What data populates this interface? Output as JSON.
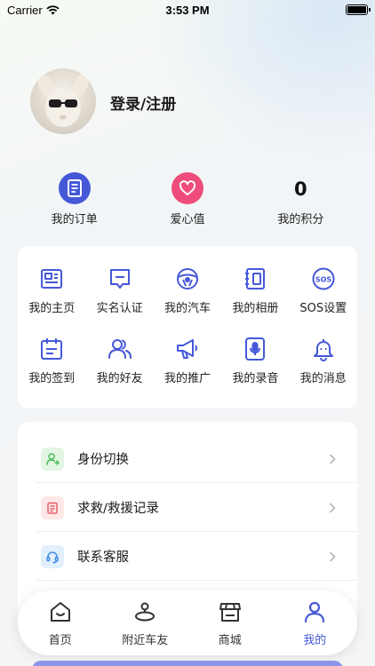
{
  "status_bar": {
    "carrier": "Carrier",
    "time": "3:53 PM"
  },
  "profile": {
    "login_label": "登录/注册"
  },
  "stats": {
    "orders_label": "我的订单",
    "love_label": "爱心值",
    "points_value": "0",
    "points_label": "我的积分"
  },
  "grid": {
    "items": [
      {
        "label": "我的主页",
        "icon": "homepage-icon"
      },
      {
        "label": "实名认证",
        "icon": "verify-icon"
      },
      {
        "label": "我的汽车",
        "icon": "steering-wheel-icon"
      },
      {
        "label": "我的相册",
        "icon": "album-icon"
      },
      {
        "label": "SOS设置",
        "icon": "sos-icon"
      },
      {
        "label": "我的签到",
        "icon": "calendar-icon"
      },
      {
        "label": "我的好友",
        "icon": "friends-icon"
      },
      {
        "label": "我的推广",
        "icon": "megaphone-icon"
      },
      {
        "label": "我的录音",
        "icon": "recording-icon"
      },
      {
        "label": "我的消息",
        "icon": "bell-icon"
      }
    ]
  },
  "list": {
    "items": [
      {
        "label": "身份切换",
        "icon": "user-switch-icon",
        "color": "#4bbf5a",
        "bg": "#e3f6e3"
      },
      {
        "label": "求救/救援记录",
        "icon": "record-icon",
        "color": "#e8606b",
        "bg": "#fde7e7"
      },
      {
        "label": "联系客服",
        "icon": "headset-icon",
        "color": "#3d8ee6",
        "bg": "#e2effc"
      }
    ]
  },
  "tab_bar": {
    "tabs": [
      {
        "label": "首页",
        "icon": "home-icon"
      },
      {
        "label": "附近车友",
        "icon": "nearby-icon"
      },
      {
        "label": "商城",
        "icon": "store-icon"
      },
      {
        "label": "我的",
        "icon": "profile-icon",
        "active": true
      }
    ]
  },
  "colors": {
    "accent": "#4558d8",
    "pink": "#ee4c7a"
  }
}
